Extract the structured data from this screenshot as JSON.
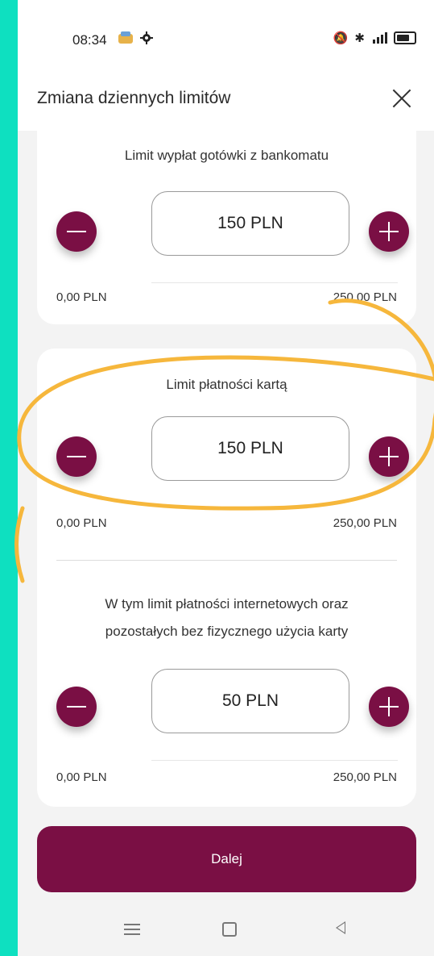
{
  "status_bar": {
    "time": "08:34",
    "icons_left": [
      "notification-icon",
      "settings-icon"
    ],
    "icons_right": [
      "mute-icon",
      "bluetooth-icon",
      "signal-icon",
      "battery-icon"
    ]
  },
  "header": {
    "title": "Zmiana dziennych limitów"
  },
  "limits": [
    {
      "label": "Limit wypłat gotówki z bankomatu",
      "value": "150 PLN",
      "min": "0,00 PLN",
      "max": "250,00 PLN"
    },
    {
      "label": "Limit płatności kartą",
      "value": "150 PLN",
      "min": "0,00 PLN",
      "max": "250,00 PLN"
    },
    {
      "label_line1": "W tym limit płatności internetowych oraz",
      "label_line2": "pozostałych bez fizycznego użycia karty",
      "value": "50 PLN",
      "min": "0,00 PLN",
      "max": "250,00 PLN"
    }
  ],
  "next_button": "Dalej",
  "colors": {
    "brand": "#7a0f44",
    "background": "#0ee0c0",
    "annotation": "#f6b73c"
  }
}
